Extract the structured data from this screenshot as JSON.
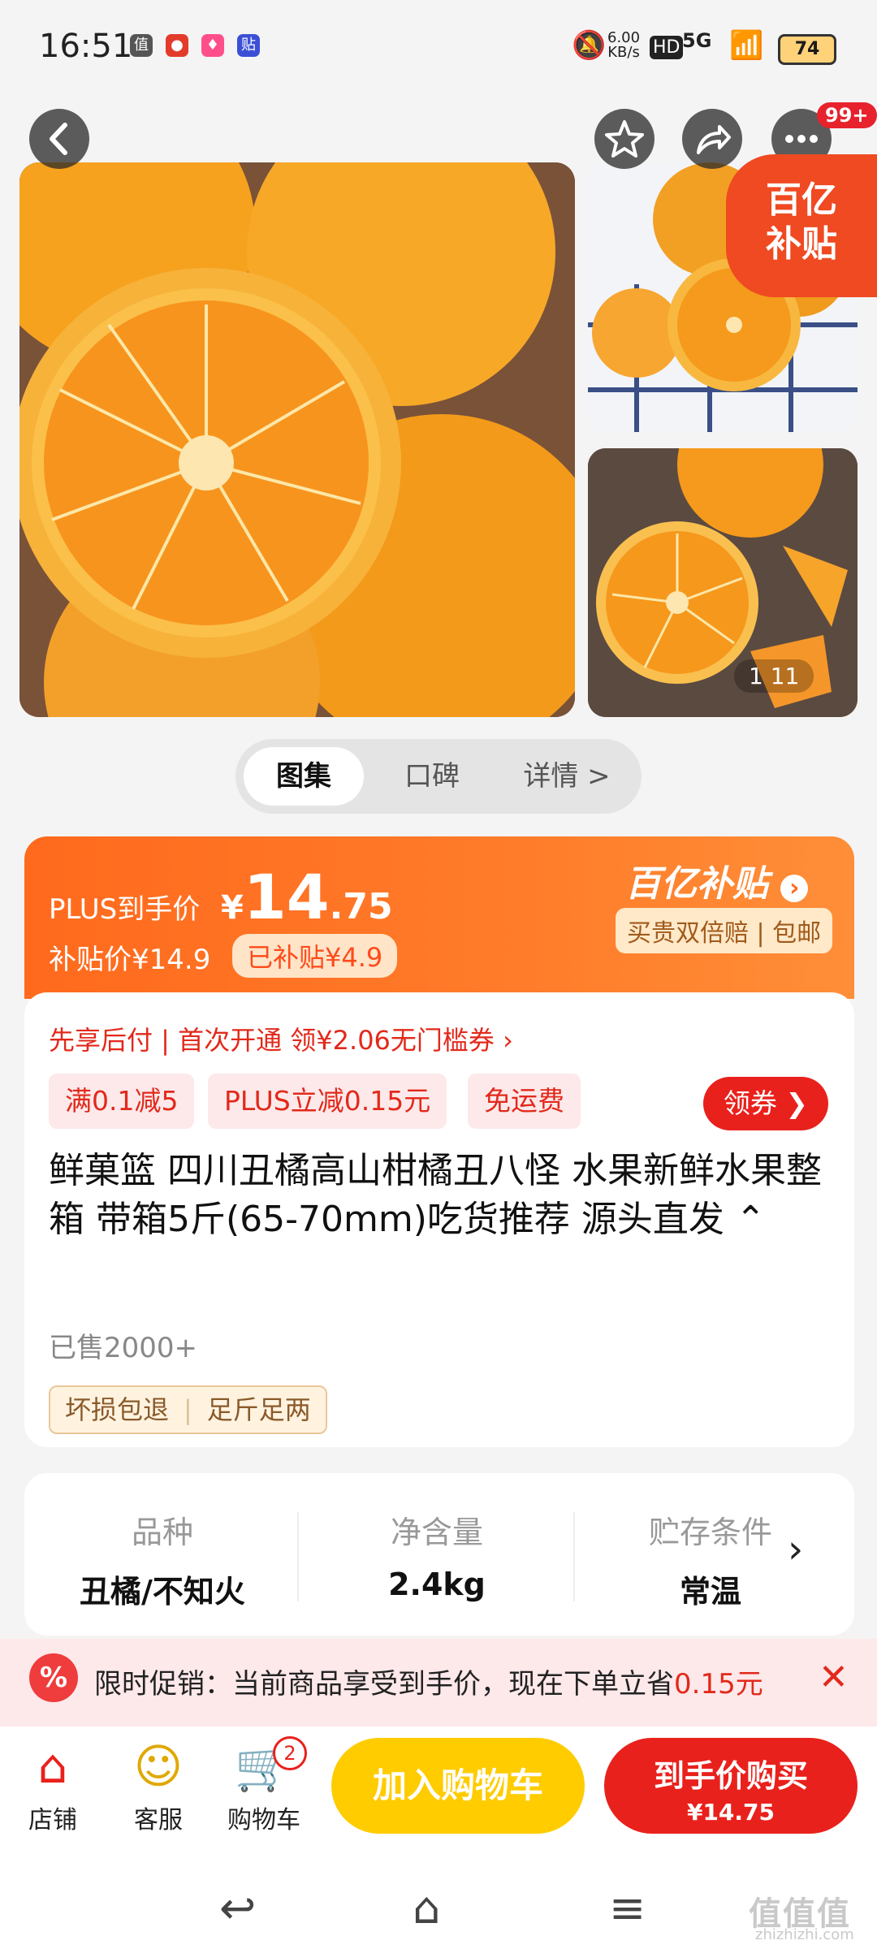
{
  "status": {
    "time": "16:51",
    "speed": "6.00",
    "speed_unit": "KB/s",
    "network": "5G",
    "battery": "74"
  },
  "gallery": {
    "badge_count": "99+",
    "subsidy_tag_line1": "百亿",
    "subsidy_tag_line2": "补贴",
    "pager": "1 11"
  },
  "tabs": [
    "图集",
    "口碑",
    "详情 >"
  ],
  "price": {
    "plus_label": "PLUS到手价",
    "currency": "¥",
    "integer": "14",
    "decimal": ".75",
    "subsidy_price": "补贴价¥14.9",
    "subsidy_chip": "已补贴¥4.9",
    "bybt_logo": "百亿补贴",
    "bybt_sub": "买贵双倍赔 | 包邮"
  },
  "product": {
    "pay_line": "先享后付 | 首次开通 领¥2.06无门槛券 ›",
    "chips": [
      "满0.1减5",
      "PLUS立减0.15元",
      "免运费"
    ],
    "coupon_button": "领券",
    "title": "鲜菓篮 四川丑橘高山柑橘丑八怪 水果新鲜水果整箱 带箱5斤(65-70mm)吃货推荐 源头直发 ⌃",
    "sold": "已售2000+",
    "services": [
      "坏损包退",
      "足斤足两"
    ]
  },
  "specs": [
    {
      "key": "品种",
      "value": "丑橘/不知火"
    },
    {
      "key": "净含量",
      "value": "2.4kg"
    },
    {
      "key": "贮存条件",
      "value": "常温"
    }
  ],
  "promo": {
    "text": "限时促销：当前商品享受到手价，现在下单立省",
    "amount": "0.15元"
  },
  "bottom": {
    "shop": "店铺",
    "service": "客服",
    "cart": "购物车",
    "cart_count": "2",
    "add_to_cart": "加入购物车",
    "buy_line1": "到手价购买",
    "buy_line2": "¥14.75"
  },
  "watermark": {
    "brand": "值值值",
    "domain": "zhizhizhi.com"
  },
  "colors": {
    "accent_red": "#e9211c",
    "accent_orange": "#ff6a1d",
    "cart_yellow": "#ffcc00"
  }
}
